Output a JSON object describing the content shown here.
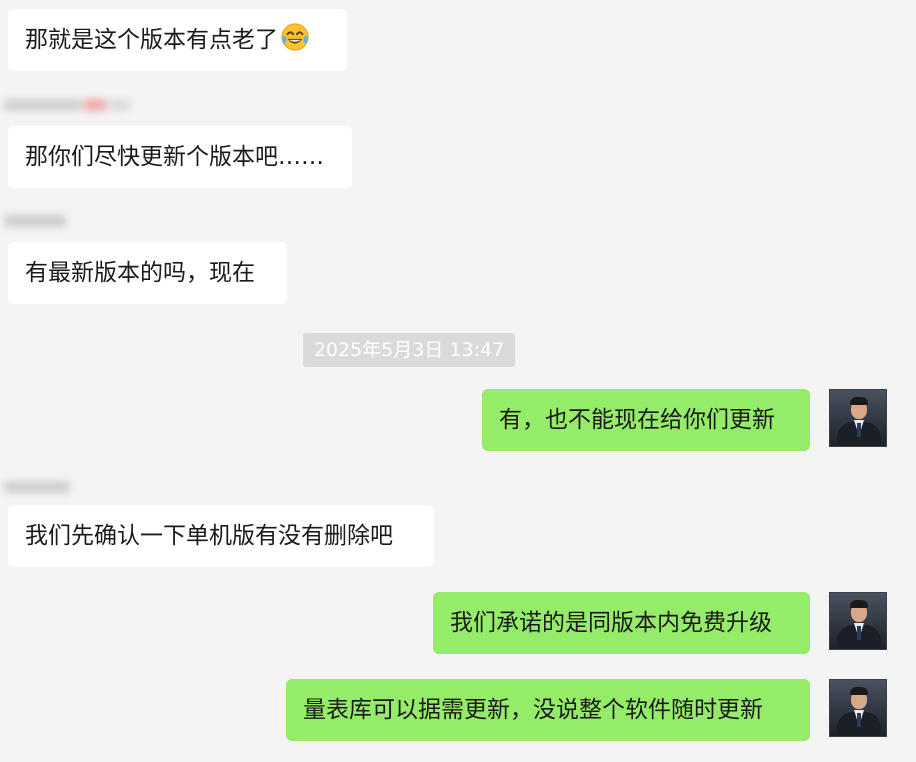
{
  "chat": {
    "messages": [
      {
        "id": "m1",
        "direction": "in",
        "text": "那就是这个版本有点老了",
        "emoji": "face-with-tears-of-joy-icon"
      },
      {
        "id": "m2",
        "direction": "in",
        "text": "那你们尽快更新个版本吧……"
      },
      {
        "id": "m3",
        "direction": "in",
        "text": "有最新版本的吗，现在"
      },
      {
        "id": "m4",
        "direction": "out",
        "text": "有，也不能现在给你们更新"
      },
      {
        "id": "m5",
        "direction": "in",
        "text": "我们先确认一下单机版有没有删除吧"
      },
      {
        "id": "m6",
        "direction": "out",
        "text": "我们承诺的是同版本内免费升级"
      },
      {
        "id": "m7",
        "direction": "out",
        "text": "量表库可以据需更新，没说整个软件随时更新"
      }
    ],
    "timestamp": "2025年5月3日 13:47"
  },
  "colors": {
    "background": "#f4f4f4",
    "incoming_bubble": "#ffffff",
    "outgoing_bubble": "#95ec69",
    "timestamp_bg": "#dadada"
  }
}
